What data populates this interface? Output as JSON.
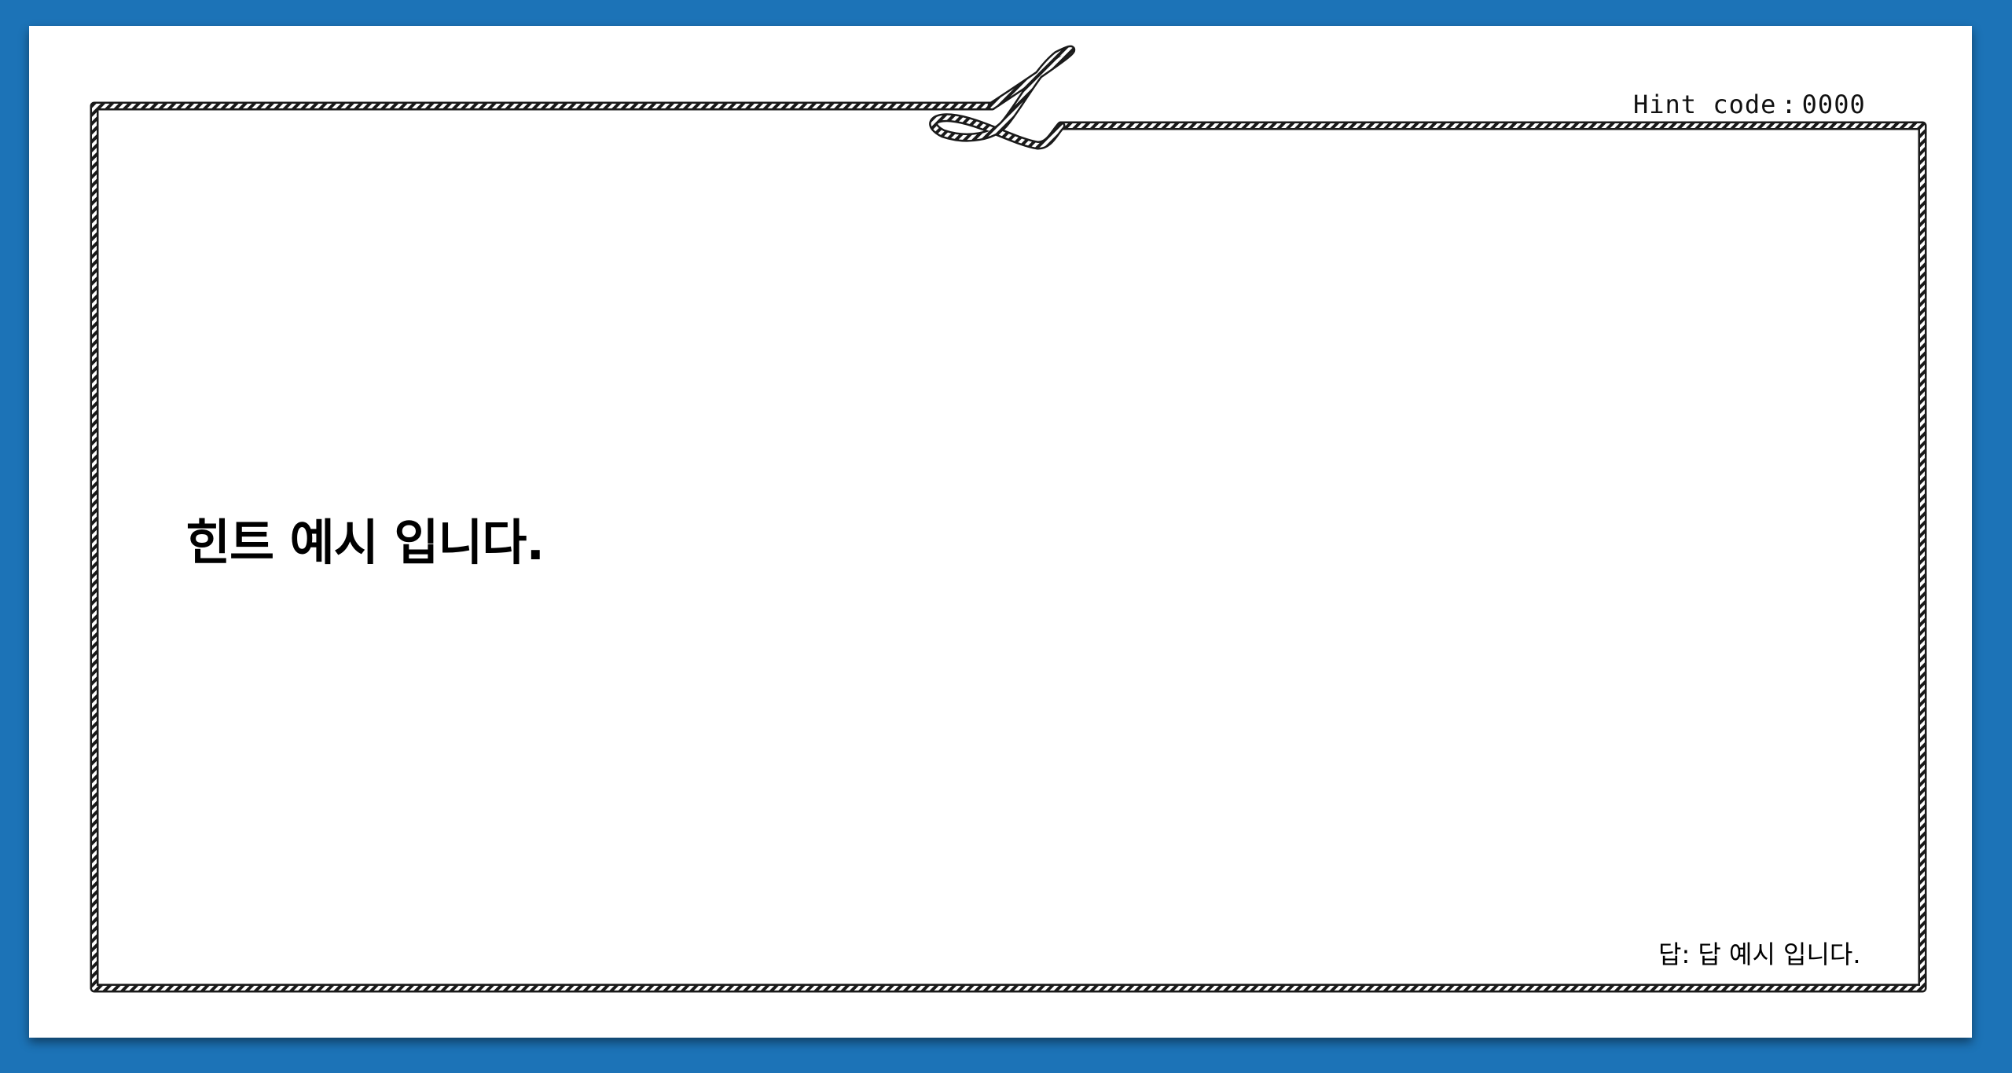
{
  "hint_code": {
    "label": "Hint code",
    "separator": ":",
    "value": "0000"
  },
  "hint": {
    "text": "힌트 예시 입니다."
  },
  "answer": {
    "text": "답: 답 예시 입니다."
  },
  "colors": {
    "background": "#1c73b7",
    "card": "#ffffff",
    "rope": "#1a1a1a",
    "text": "#000000"
  },
  "icons": [
    "rope-border-icon",
    "rope-loop-icon"
  ]
}
